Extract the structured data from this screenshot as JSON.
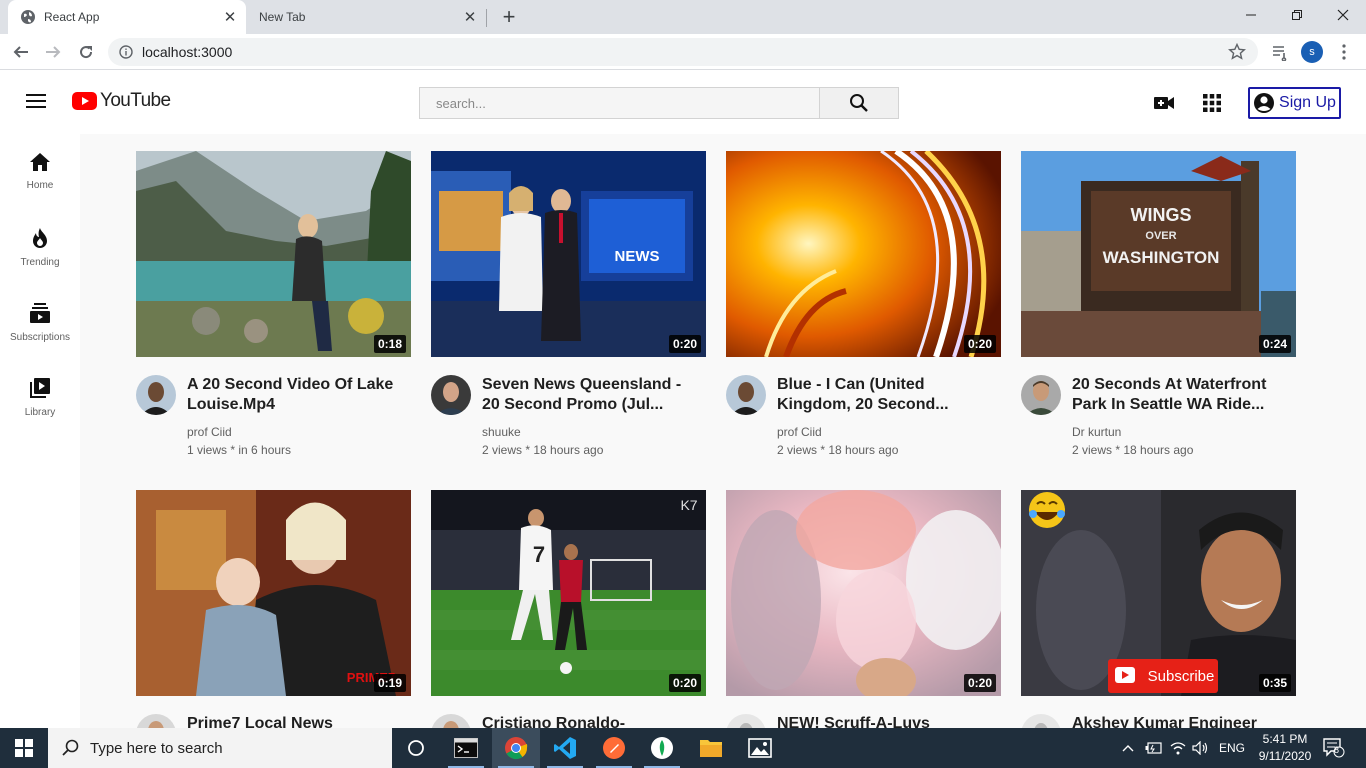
{
  "browser": {
    "tabs": [
      {
        "title": "React App",
        "active": true
      },
      {
        "title": "New Tab",
        "active": false
      }
    ],
    "url": "localhost:3000",
    "profile_initial": "s"
  },
  "header": {
    "logo_text": "YouTube",
    "search_placeholder": "search...",
    "signup_label": "Sign Up"
  },
  "sidebar": {
    "items": [
      {
        "label": "Home",
        "icon": "home-icon"
      },
      {
        "label": "Trending",
        "icon": "fire-icon"
      },
      {
        "label": "Subscriptions",
        "icon": "subscriptions-icon"
      },
      {
        "label": "Library",
        "icon": "library-icon"
      }
    ]
  },
  "videos": [
    {
      "title": "A 20 Second Video Of Lake Louise.Mp4",
      "channel": "prof Ciid",
      "stats": "1 views * in 6 hours",
      "duration": "0:18"
    },
    {
      "title": "Seven News Queensland - 20 Second Promo (Jul...",
      "channel": "shuuke",
      "stats": "2 views * 18 hours ago",
      "duration": "0:20"
    },
    {
      "title": "Blue - I Can (United Kingdom, 20 Second...",
      "channel": "prof Ciid",
      "stats": "2 views * 18 hours ago",
      "duration": "0:20"
    },
    {
      "title": "20 Seconds At Waterfront Park In Seattle WA Ride...",
      "channel": "Dr kurtun",
      "stats": "2 views * 18 hours ago",
      "duration": "0:24"
    },
    {
      "title": "Prime7 Local News",
      "channel": "",
      "stats": "",
      "duration": "0:19",
      "overlay": "PRIME7"
    },
    {
      "title": "Cristiano Ronaldo-",
      "channel": "",
      "stats": "",
      "duration": "0:20",
      "overlay": "K7"
    },
    {
      "title": "NEW! Scruff-A-Luvs",
      "channel": "",
      "stats": "",
      "duration": "0:20"
    },
    {
      "title": "Akshey Kumar Engineer",
      "channel": "",
      "stats": "",
      "duration": "0:35",
      "overlay": "Subscribe"
    }
  ],
  "thumb_overlays": {
    "news": "NEWS",
    "sign_line1": "WINGS",
    "sign_line2": "OVER",
    "sign_line3": "WASHINGTON",
    "jersey": "7"
  },
  "taskbar": {
    "search_placeholder": "Type here to search",
    "language": "ENG",
    "time": "5:41 PM",
    "date": "9/11/2020",
    "notification_count": "8"
  }
}
